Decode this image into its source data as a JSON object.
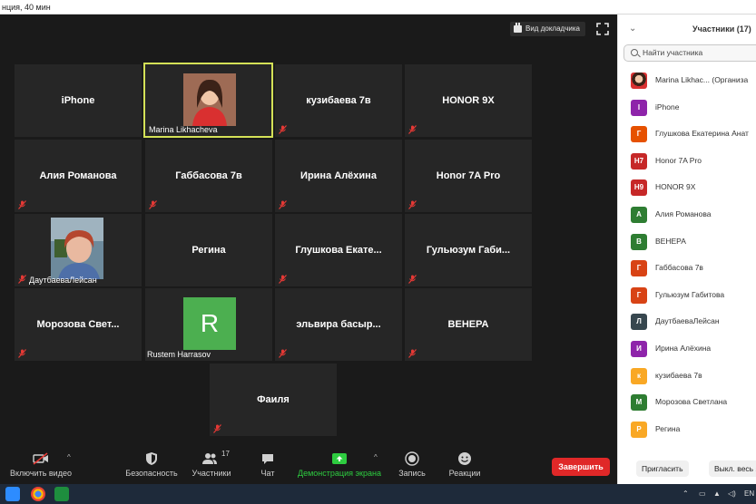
{
  "window": {
    "title": "нция, 40 мин"
  },
  "meeting": {
    "speaker_view_label": "Вид докладчика",
    "tiles": [
      {
        "name": "iPhone",
        "type": "name"
      },
      {
        "name": "Marina Likhacheva",
        "type": "video",
        "active": true
      },
      {
        "name": "кузибаева 7в",
        "type": "name"
      },
      {
        "name": "HONOR 9X",
        "type": "name"
      },
      {
        "name": "Алия Романова",
        "type": "name"
      },
      {
        "name": "Габбасова 7в",
        "type": "name"
      },
      {
        "name": "Ирина Алёхина",
        "type": "name"
      },
      {
        "name": "Honor 7A Pro",
        "type": "name"
      },
      {
        "name": "ДаутбаеваЛейсан",
        "type": "video"
      },
      {
        "name": "Регина",
        "type": "name"
      },
      {
        "name": "Глушкова Екате...",
        "type": "name"
      },
      {
        "name": "Гульюзум Габи...",
        "type": "name"
      },
      {
        "name": "Морозова Свет...",
        "type": "name"
      },
      {
        "name": "Rustem Harrasov",
        "type": "avatar",
        "avatar_letter": "R"
      },
      {
        "name": "эльвира басыр...",
        "type": "name"
      },
      {
        "name": "ВЕНЕРА",
        "type": "name"
      },
      {
        "name": "Фаиля",
        "type": "name"
      }
    ]
  },
  "toolbar": {
    "video_label": "Включить видео",
    "security_label": "Безопасность",
    "participants_label": "Участники",
    "participants_count": "17",
    "chat_label": "Чат",
    "share_label": "Демонстрация экрана",
    "record_label": "Запись",
    "reactions_label": "Реакции",
    "end_label": "Завершить"
  },
  "panel": {
    "title": "Участники (17)",
    "search_placeholder": "Найти участника",
    "participants": [
      {
        "initials": "",
        "name": "Marina Likhac... (Организа",
        "color": "#8d5a4a",
        "photo": true
      },
      {
        "initials": "I",
        "name": "iPhone",
        "color": "#8e24aa"
      },
      {
        "initials": "Г",
        "name": "Глушкова Екатерина Анат",
        "color": "#e65100"
      },
      {
        "initials": "H7",
        "name": "Honor 7A Pro",
        "color": "#c62828"
      },
      {
        "initials": "H9",
        "name": "HONOR 9X",
        "color": "#c62828"
      },
      {
        "initials": "А",
        "name": "Алия Романова",
        "color": "#2e7d32"
      },
      {
        "initials": "В",
        "name": "ВЕНЕРА",
        "color": "#2e7d32"
      },
      {
        "initials": "Г",
        "name": "Габбасова 7в",
        "color": "#d84315"
      },
      {
        "initials": "Г",
        "name": "Гульюзум Габитова",
        "color": "#d84315"
      },
      {
        "initials": "Л",
        "name": "ДаутбаеваЛейсан",
        "color": "#37474f"
      },
      {
        "initials": "И",
        "name": "Ирина Алёхина",
        "color": "#8e24aa"
      },
      {
        "initials": "к",
        "name": "кузибаева 7в",
        "color": "#f9a825"
      },
      {
        "initials": "М",
        "name": "Морозова Светлана",
        "color": "#2e7d32"
      },
      {
        "initials": "Р",
        "name": "Регина",
        "color": "#f9a825"
      }
    ],
    "invite_label": "Пригласить",
    "mute_all_label": "Выкл. весь з"
  },
  "taskbar": {
    "lang": "EN"
  },
  "colors": {
    "end": "#e02828",
    "share": "#2ecc40",
    "active_border": "#d4e157"
  }
}
